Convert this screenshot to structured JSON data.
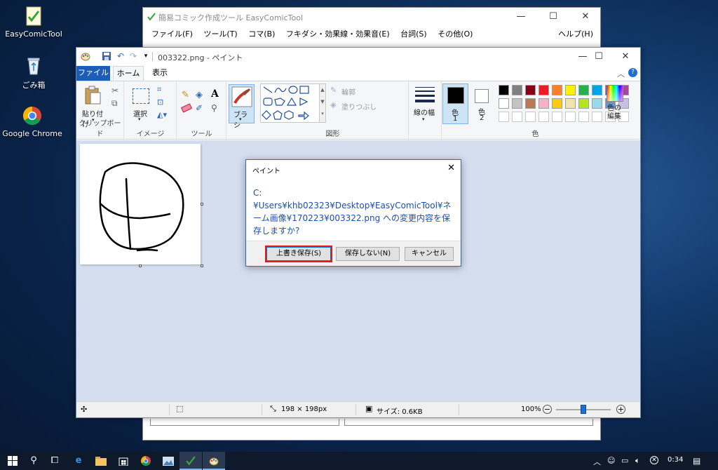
{
  "desktop": {
    "icons": [
      {
        "label": "EasyComicTool",
        "icon": "easycomictool-icon"
      },
      {
        "label": "ごみ箱",
        "icon": "recycle-bin-icon"
      },
      {
        "label": "Google Chrome",
        "icon": "chrome-icon"
      }
    ]
  },
  "ect_window": {
    "title": "簡易コミック作成ツール EasyComicTool",
    "menu": [
      "ファイル(F)",
      "ツール(T)",
      "コマ(B)",
      "フキダシ・効果線・効果音(E)",
      "台詞(S)",
      "その他(O)",
      "ヘルプ(H)"
    ],
    "controls": {
      "minimize": "—",
      "maximize": "☐",
      "close": "✕"
    }
  },
  "paint_window": {
    "title": "003322.png - ペイント",
    "controls": {
      "minimize": "—",
      "maximize": "☐",
      "close": "✕"
    },
    "tabs": {
      "file": "ファイル",
      "home": "ホーム",
      "view": "表示"
    },
    "ribbon": {
      "clipboard": {
        "paste": "貼り付け",
        "group": "クリップボード"
      },
      "image": {
        "select": "選択",
        "group": "イメージ"
      },
      "tools": {
        "group": "ツール"
      },
      "brush": {
        "label": "ブラシ"
      },
      "shapes": {
        "outline": "輪郭",
        "fill": "塗りつぶし",
        "group": "図形"
      },
      "size": {
        "label": "線の幅"
      },
      "color1": {
        "label": "色",
        "index": "1"
      },
      "color2": {
        "label": "色",
        "index": "2"
      },
      "colors": {
        "group": "色"
      },
      "edit_colors": {
        "label": "色の\n編集"
      }
    },
    "palette": [
      "#000000",
      "#7f7f7f",
      "#880015",
      "#ed1c24",
      "#ff7f27",
      "#fff200",
      "#22b14c",
      "#00a2e8",
      "#3f48cc",
      "#a349a4",
      "#ffffff",
      "#c3c3c3",
      "#b97a57",
      "#ffaec9",
      "#ffc90e",
      "#efe4b0",
      "#b5e61d",
      "#99d9ea",
      "#7092be",
      "#c8bfe7",
      "#ffffff",
      "#ffffff",
      "#ffffff",
      "#ffffff",
      "#ffffff",
      "#ffffff",
      "#ffffff",
      "#ffffff",
      "#ffffff",
      "#ffffff"
    ],
    "status": {
      "image_size": "198 × 198px",
      "file_size": "サイズ: 0.6KB",
      "zoom": "100%"
    }
  },
  "dialog": {
    "title": "ペイント",
    "message": "C:¥Users¥khb02323¥Desktop¥EasyComicTool¥ネーム画像¥170223¥003322.png への変更内容を保存しますか?",
    "buttons": {
      "save": "上書き保存(S)",
      "dont_save": "保存しない(N)",
      "cancel": "キャンセル"
    },
    "close": "✕"
  },
  "taskbar": {
    "clock": "0:34"
  }
}
